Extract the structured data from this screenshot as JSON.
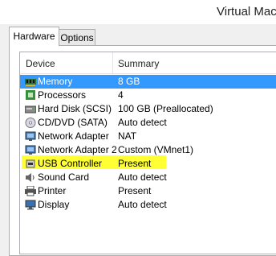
{
  "window": {
    "title": "Virtual Mac"
  },
  "tabs": [
    {
      "label": "Hardware",
      "active": true
    },
    {
      "label": "Options",
      "active": false
    }
  ],
  "device_list": {
    "columns": {
      "device": "Device",
      "summary": "Summary"
    },
    "rows": [
      {
        "device": "Memory",
        "summary": "8 GB",
        "icon": "memory-icon",
        "selected": true
      },
      {
        "device": "Processors",
        "summary": "4",
        "icon": "processor-icon"
      },
      {
        "device": "Hard Disk (SCSI)",
        "summary": "100 GB (Preallocated)",
        "icon": "hard-disk-icon"
      },
      {
        "device": "CD/DVD (SATA)",
        "summary": "Auto detect",
        "icon": "cd-dvd-icon"
      },
      {
        "device": "Network Adapter",
        "summary": "NAT",
        "icon": "network-adapter-icon"
      },
      {
        "device": "Network Adapter 2",
        "summary": "Custom (VMnet1)",
        "icon": "network-adapter-icon"
      },
      {
        "device": "USB Controller",
        "summary": "Present",
        "icon": "usb-controller-icon"
      },
      {
        "device": "Sound Card",
        "summary": "Auto detect",
        "icon": "sound-card-icon"
      },
      {
        "device": "Printer",
        "summary": "Present",
        "icon": "printer-icon",
        "highlighted": true
      },
      {
        "device": "Display",
        "summary": "Auto detect",
        "icon": "display-icon"
      }
    ]
  },
  "colors": {
    "selection": "#3399ff",
    "highlight": "#ffff33"
  }
}
